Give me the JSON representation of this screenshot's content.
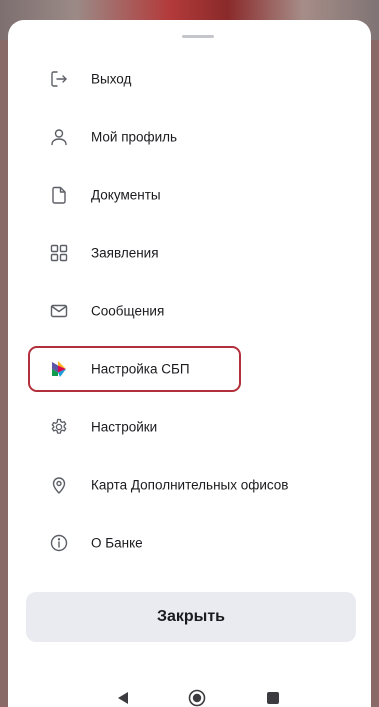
{
  "menu": {
    "items": [
      {
        "label": "Выход",
        "icon": "logout-icon"
      },
      {
        "label": "Мой профиль",
        "icon": "profile-icon"
      },
      {
        "label": "Документы",
        "icon": "document-icon"
      },
      {
        "label": "Заявления",
        "icon": "applications-grid-icon"
      },
      {
        "label": "Сообщения",
        "icon": "envelope-icon"
      },
      {
        "label": "Настройка СБП",
        "icon": "sbp-logo-icon",
        "highlighted": true
      },
      {
        "label": "Настройки",
        "icon": "gear-icon"
      },
      {
        "label": "Карта Дополнительных офисов",
        "icon": "map-pin-icon"
      },
      {
        "label": "О Банке",
        "icon": "info-icon"
      }
    ]
  },
  "close_button": {
    "label": "Закрыть"
  },
  "colors": {
    "highlight_border": "#b2303c",
    "icon_stroke": "#5c5f66",
    "button_bg": "#eaebf0"
  },
  "system_nav": {
    "buttons": [
      "back-icon",
      "home-icon",
      "recent-apps-icon"
    ]
  }
}
